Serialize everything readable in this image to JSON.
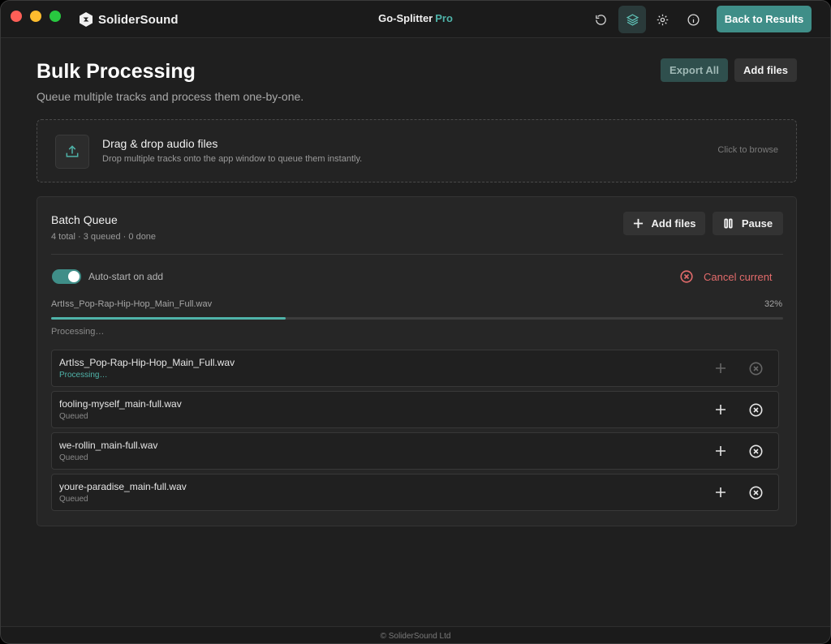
{
  "window": {
    "brand": "SoliderSound",
    "app_title": "Go-Splitter",
    "app_title_badge": "Pro",
    "back_button": "Back to Results",
    "icons": [
      "refresh-icon",
      "layers-icon",
      "settings-icon",
      "info-icon"
    ]
  },
  "header": {
    "title": "Bulk Processing",
    "subtitle": "Queue multiple tracks and process them one-by-one.",
    "export_all": "Export All",
    "add_files": "Add files"
  },
  "dropzone": {
    "title": "Drag & drop audio files",
    "subtitle": "Drop multiple tracks onto the app window to queue them instantly.",
    "browse": "Click to browse"
  },
  "queue": {
    "title": "Batch Queue",
    "stats": "4 total · 3 queued · 0 done",
    "add_files": "Add files",
    "pause": "Pause",
    "auto_start_label": "Auto-start on add",
    "auto_start_enabled": true,
    "cancel_current": "Cancel current",
    "current_file": "ArtIss_Pop-Rap-Hip-Hop_Main_Full.wav",
    "current_percent_label": "32%",
    "current_progress": 0.32,
    "current_status": "Processing…",
    "items": [
      {
        "name": "ArtIss_Pop-Rap-Hip-Hop_Main_Full.wav",
        "status": "Processing…",
        "active": true
      },
      {
        "name": "fooling-myself_main-full.wav",
        "status": "Queued",
        "active": false
      },
      {
        "name": "we-rollin_main-full.wav",
        "status": "Queued",
        "active": false
      },
      {
        "name": "youre-paradise_main-full.wav",
        "status": "Queued",
        "active": false
      }
    ]
  },
  "footer": {
    "text": "© SoliderSound Ltd"
  },
  "colors": {
    "accent": "#4fb3a9",
    "accent_button": "#3f8e88",
    "danger": "#e26b6b",
    "background": "#1f1f1f",
    "panel": "#262626"
  }
}
